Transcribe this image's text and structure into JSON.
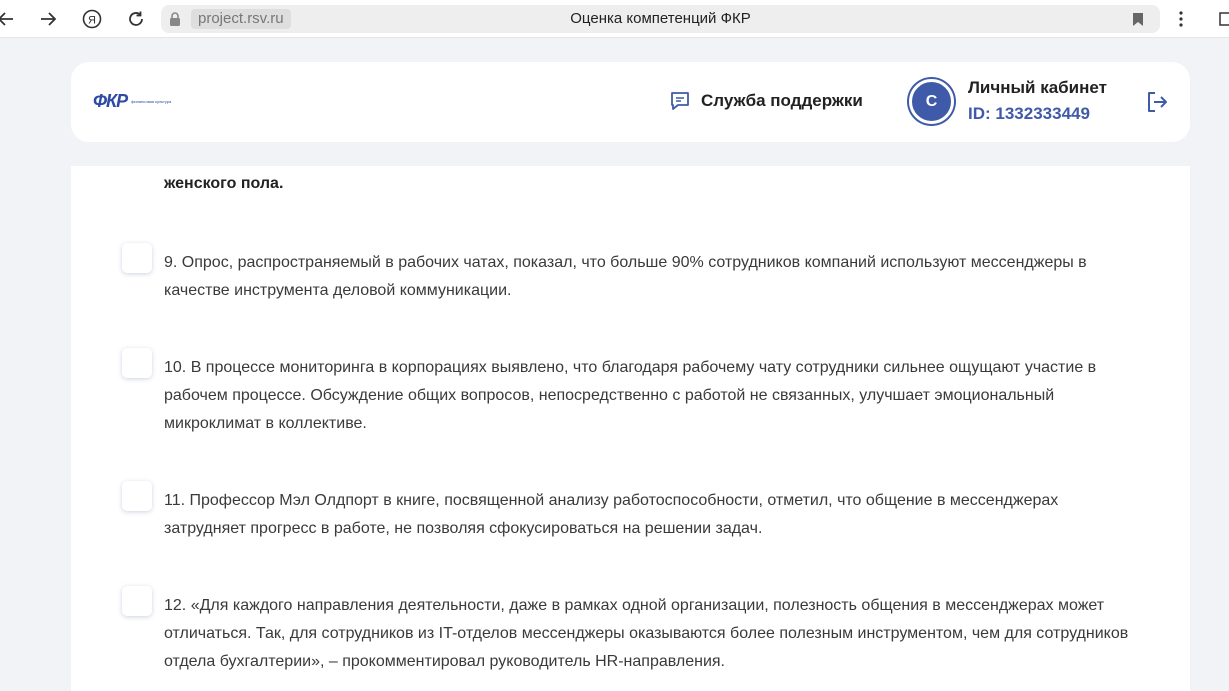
{
  "browser": {
    "url": "project.rsv.ru",
    "tab_title": "Оценка компетенций ФКР"
  },
  "header": {
    "logo_text": "ФКР",
    "logo_subtitle": "финансовая культура",
    "support_label": "Служба поддержки",
    "avatar_initial": "С",
    "cabinet_label": "Личный кабинет",
    "user_id": "ID: 1332333449"
  },
  "content": {
    "previous_tail": "женского пола.",
    "items": [
      {
        "text": "9. Опрос, распространяемый в рабочих чатах, показал, что больше 90% сотрудников компаний используют мессенджеры в качестве инструмента деловой коммуникации."
      },
      {
        "text": "10. В процессе мониторинга в корпорациях выявлено, что благодаря рабочему чату сотрудники сильнее ощущают участие в рабочем процессе. Обсуждение общих вопросов, непосредственно с работой не связанных, улучшает эмоциональный микроклимат в коллективе."
      },
      {
        "text": "11. Профессор Мэл Олдпорт в книге, посвященной анализу работоспособности, отметил, что общение в мессенджерах затрудняет прогресс в работе, не позволяя сфокусироваться на решении задач."
      },
      {
        "text": "12. «Для каждого направления деятельности, даже в рамках одной организации, полезность общения в мессенджерах может отличаться. Так, для сотрудников из IT-отделов мессенджеры оказываются более полезным инструментом, чем для сотрудников отдела бухгалтерии», – прокомментировал руководитель HR-направления."
      }
    ]
  },
  "icons": {
    "back": "back-arrow-icon",
    "forward": "forward-arrow-icon",
    "yandex": "yandex-icon",
    "reload": "reload-icon",
    "lock": "lock-icon",
    "bookmark": "bookmark-icon",
    "menu": "kebab-menu-icon",
    "support": "chat-icon",
    "logout": "logout-icon"
  },
  "colors": {
    "brand": "#3f5aa8",
    "page_bg": "#f1f3f7"
  }
}
